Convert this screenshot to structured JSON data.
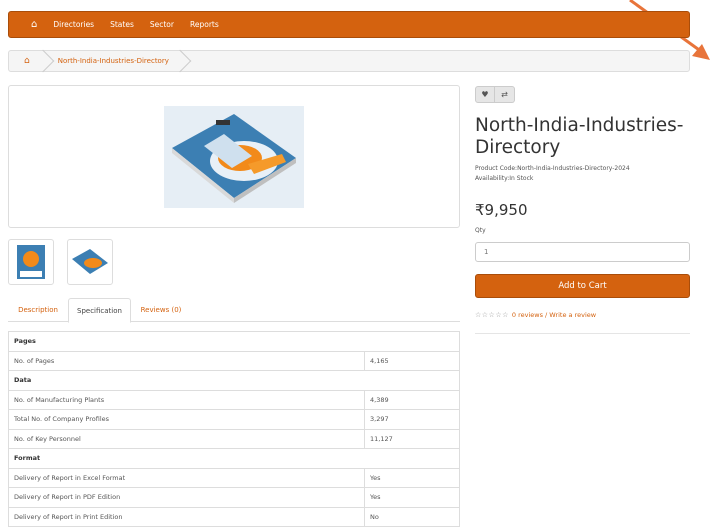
{
  "nav": {
    "items": [
      "Directories",
      "States",
      "Sector",
      "Reports"
    ]
  },
  "breadcrumb": {
    "current": "North-India-Industries-Directory"
  },
  "tabs": [
    "Description",
    "Specification",
    "Reviews (0)"
  ],
  "spec": {
    "groups": [
      {
        "title": "Pages",
        "rows": [
          [
            "No. of Pages",
            "4,165"
          ]
        ]
      },
      {
        "title": "Data",
        "rows": [
          [
            "No. of Manufacturing Plants",
            "4,389"
          ],
          [
            "Total No. of Company Profiles",
            "3,297"
          ],
          [
            "No. of Key Personnel",
            "11,127"
          ]
        ]
      },
      {
        "title": "Format",
        "rows": [
          [
            "Delivery of Report in Excel Format",
            "Yes"
          ],
          [
            "Delivery of Report in PDF Edition",
            "Yes"
          ],
          [
            "Delivery of Report in Print Edition",
            "No"
          ]
        ]
      }
    ]
  },
  "product": {
    "title_line1": "North-India-Industries-",
    "title_line2": "Directory",
    "code": "Product Code:North-India-Industries-Directory-2024",
    "availability": "Availability:In Stock",
    "price": "₹9,950",
    "qty_label": "Qty",
    "qty_value": "1",
    "cart_label": "Add to Cart",
    "stars": "☆☆☆☆☆",
    "reviews_link": "0 reviews / Write a review"
  },
  "colors": {
    "accent": "#d4620f"
  }
}
